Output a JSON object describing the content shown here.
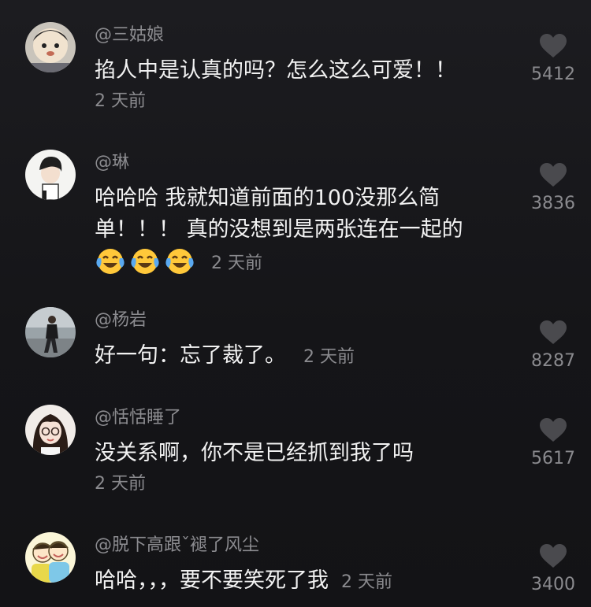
{
  "comments": [
    {
      "username": "@三姑娘",
      "text": "掐人中是认真的吗？怎么这么可爱！！",
      "time": "2 天前",
      "likes": "5412",
      "avatar": "cartoon-face-avatar"
    },
    {
      "username": "@琳",
      "text_line1": "哈哈哈 我就知道前面的100没那么简",
      "text_line2": "单！！！ 真的没想到是两张连在一起的",
      "emoji": "laughing-crying-emoji",
      "emoji_count": 3,
      "time": "2 天前",
      "likes": "3836",
      "avatar": "boy-illustration-avatar"
    },
    {
      "username": "@杨岩",
      "text": "好一句：忘了裁了。",
      "time": "2 天前",
      "likes": "8287",
      "avatar": "man-walking-avatar"
    },
    {
      "username": "@恬恬睡了",
      "text": "没关系啊，你不是已经抓到我了吗",
      "time": "2 天前",
      "likes": "5617",
      "avatar": "girl-glasses-avatar"
    },
    {
      "username": "@脱下高跟ˇ褪了风尘",
      "text": "哈哈，，，要不要笑死了我",
      "time": "2 天前",
      "likes": "3400",
      "avatar": "cartoon-kids-avatar"
    }
  ],
  "colors": {
    "background": "#18181c",
    "username": "#8c8c90",
    "text": "#f2f2f2",
    "meta": "#8a8a8e",
    "heart": "#4a4a4e"
  },
  "icons": {
    "like": "heart-icon"
  }
}
